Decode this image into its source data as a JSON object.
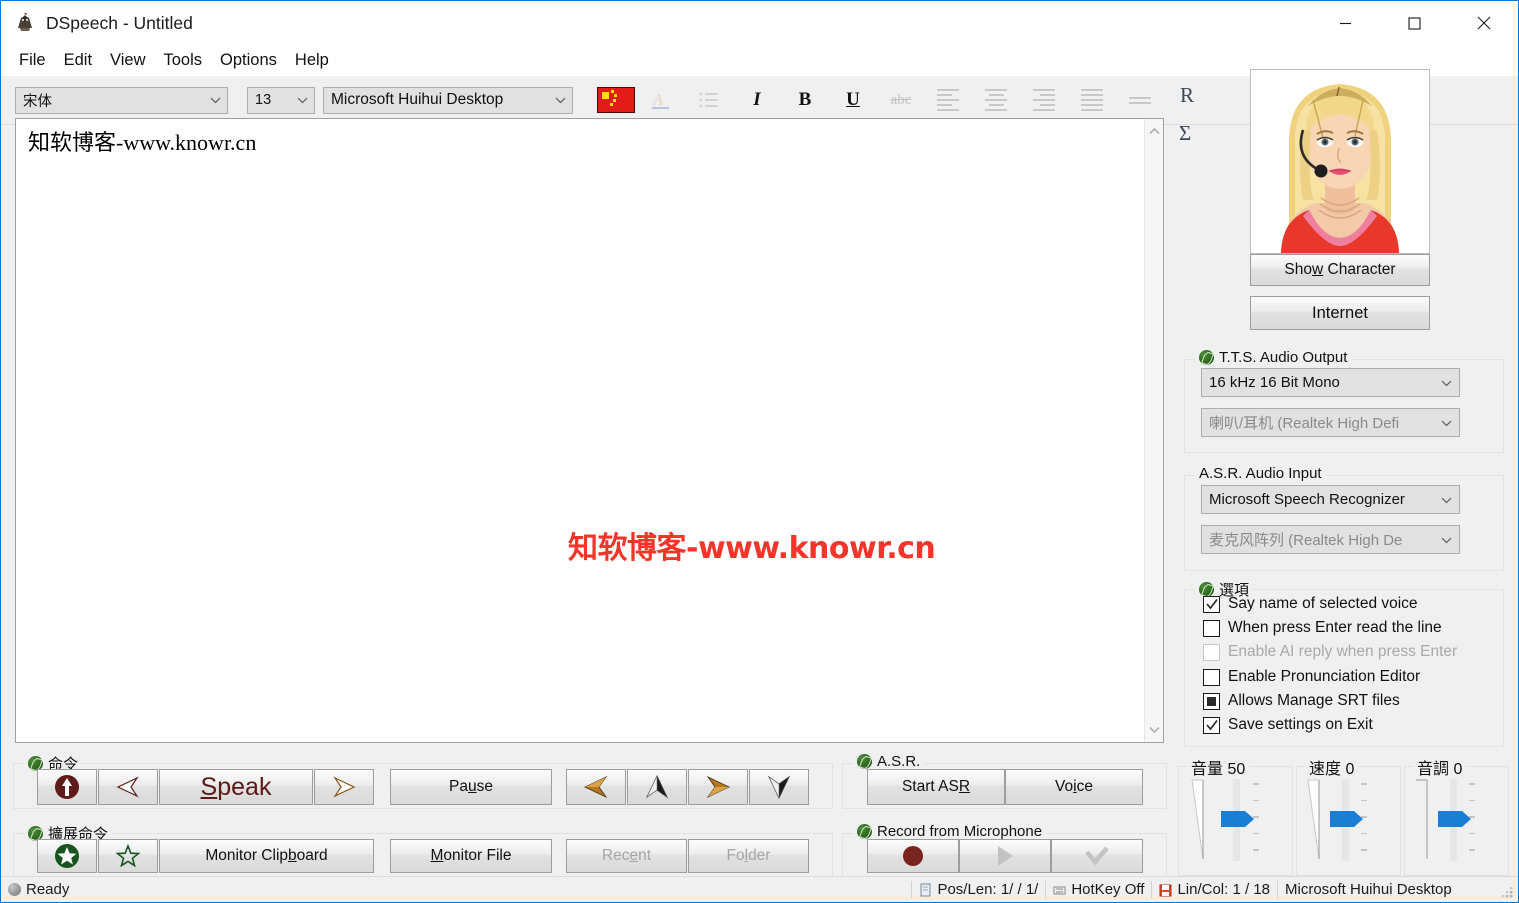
{
  "window": {
    "title": "DSpeech - Untitled",
    "app_icon": "dspeech-icon",
    "controls": {
      "minimize": "minimize-icon",
      "maximize": "maximize-icon",
      "close": "close-icon"
    }
  },
  "menu": {
    "items": [
      "File",
      "Edit",
      "View",
      "Tools",
      "Options",
      "Help"
    ]
  },
  "toolbar": {
    "font_family": "宋体",
    "font_size": "13",
    "voice": "Microsoft Huihui Desktop",
    "icons": [
      {
        "name": "china-flag-icon",
        "glyph": "flag",
        "enabled": true
      },
      {
        "name": "font-color-icon",
        "glyph": "A",
        "enabled": false
      },
      {
        "name": "bullet-list-icon",
        "glyph": "list",
        "enabled": false
      },
      {
        "name": "italic-icon",
        "glyph": "I",
        "enabled": true
      },
      {
        "name": "bold-icon",
        "glyph": "B",
        "enabled": true
      },
      {
        "name": "underline-icon",
        "glyph": "U",
        "enabled": true
      },
      {
        "name": "strikethrough-icon",
        "glyph": "abc",
        "enabled": false
      },
      {
        "name": "align-left-icon",
        "glyph": "lines",
        "enabled": false
      },
      {
        "name": "align-center-icon",
        "glyph": "lines",
        "enabled": false
      },
      {
        "name": "align-right-icon",
        "glyph": "lines",
        "enabled": false
      },
      {
        "name": "align-justify-icon",
        "glyph": "lines",
        "enabled": false
      },
      {
        "name": "line-spacing-icon",
        "glyph": "lines2",
        "enabled": false
      }
    ]
  },
  "editor": {
    "content": "知软博客-www.knowr.cn",
    "watermark": "知软博客-www.knowr.cn"
  },
  "side_buttons": {
    "reading": "R",
    "sum": "Σ"
  },
  "character": {
    "show_button": {
      "prefix": "Sho",
      "accel": "w",
      "suffix": " Character"
    },
    "internet_button": "Internet"
  },
  "tts_output": {
    "legend": "T.T.S. Audio Output",
    "format": "16 kHz 16 Bit Mono",
    "device": "喇叭/耳机 (Realtek High Defi"
  },
  "asr_input": {
    "legend": "A.S.R. Audio Input",
    "engine": "Microsoft Speech Recognizer",
    "device": "麦克风阵列 (Realtek High De"
  },
  "options": {
    "legend": "選項",
    "items": [
      {
        "label": "Say name of selected voice",
        "state": "checked",
        "enabled": true
      },
      {
        "label": "When press Enter read the line",
        "state": "unchecked",
        "enabled": true
      },
      {
        "label": "Enable AI reply when press Enter",
        "state": "unchecked",
        "enabled": false
      },
      {
        "label": "Enable Pronunciation Editor",
        "state": "unchecked",
        "enabled": true
      },
      {
        "label": "Allows Manage SRT files",
        "state": "indeterminate",
        "enabled": true
      },
      {
        "label": "Save settings on Exit",
        "state": "checked",
        "enabled": true
      }
    ]
  },
  "commands": {
    "legend": "命令",
    "record_icon": "record-arrow-up-icon",
    "prev_icon": "arrow-left-icon",
    "speak": {
      "accel": "S",
      "rest": "peak"
    },
    "next_icon": "arrow-right-icon",
    "pause": {
      "prefix": "Pa",
      "accel": "u",
      "suffix": "se"
    },
    "nav_icons": [
      "arrow-left-gold-icon",
      "arrow-up-gold-icon",
      "arrow-right-gold-icon",
      "arrow-down-gold-icon"
    ]
  },
  "extended_commands": {
    "legend": "擴展命令",
    "star_filled_icon": "star-filled-icon",
    "star_outline_icon": "star-outline-icon",
    "monitor_clipboard": {
      "prefix": "Monitor Clip",
      "accel": "b",
      "suffix": "oard"
    },
    "monitor_file": {
      "accel": "M",
      "rest": "onitor File"
    },
    "recent": {
      "prefix": "Rec",
      "accel": "e",
      "suffix": "nt",
      "enabled": false
    },
    "folder": {
      "prefix": "Fo",
      "accel": "l",
      "suffix": "der",
      "enabled": false
    }
  },
  "asr": {
    "legend": "A.S.R.",
    "start": {
      "prefix": "Start AS",
      "accel": "R",
      "suffix": ""
    },
    "voice": {
      "prefix": "Vo",
      "accel": "i",
      "suffix": "ce"
    }
  },
  "record": {
    "legend": "Record from Microphone",
    "buttons": [
      {
        "name": "record-button",
        "icon": "record-circle-icon",
        "enabled": true
      },
      {
        "name": "play-button",
        "icon": "play-triangle-icon",
        "enabled": false
      },
      {
        "name": "accept-button",
        "icon": "check-icon",
        "enabled": false
      }
    ]
  },
  "sliders": [
    {
      "name": "volume",
      "label": "音量 50",
      "value": 50
    },
    {
      "name": "speed",
      "label": "速度 0",
      "value": 0
    },
    {
      "name": "pitch",
      "label": "音調 0",
      "value": 0
    }
  ],
  "statusbar": {
    "state": "Ready",
    "pos_len": "Pos/Len: 1/ / 1/",
    "hotkey": "HotKey Off",
    "lin_col": "Lin/Col: 1 / 18",
    "voice": "Microsoft Huihui Desktop"
  },
  "colors": {
    "accent": "#0078d7",
    "watermark": "#f5352a",
    "flag_red": "#e11b17",
    "slider_thumb": "#1a7fd4"
  }
}
